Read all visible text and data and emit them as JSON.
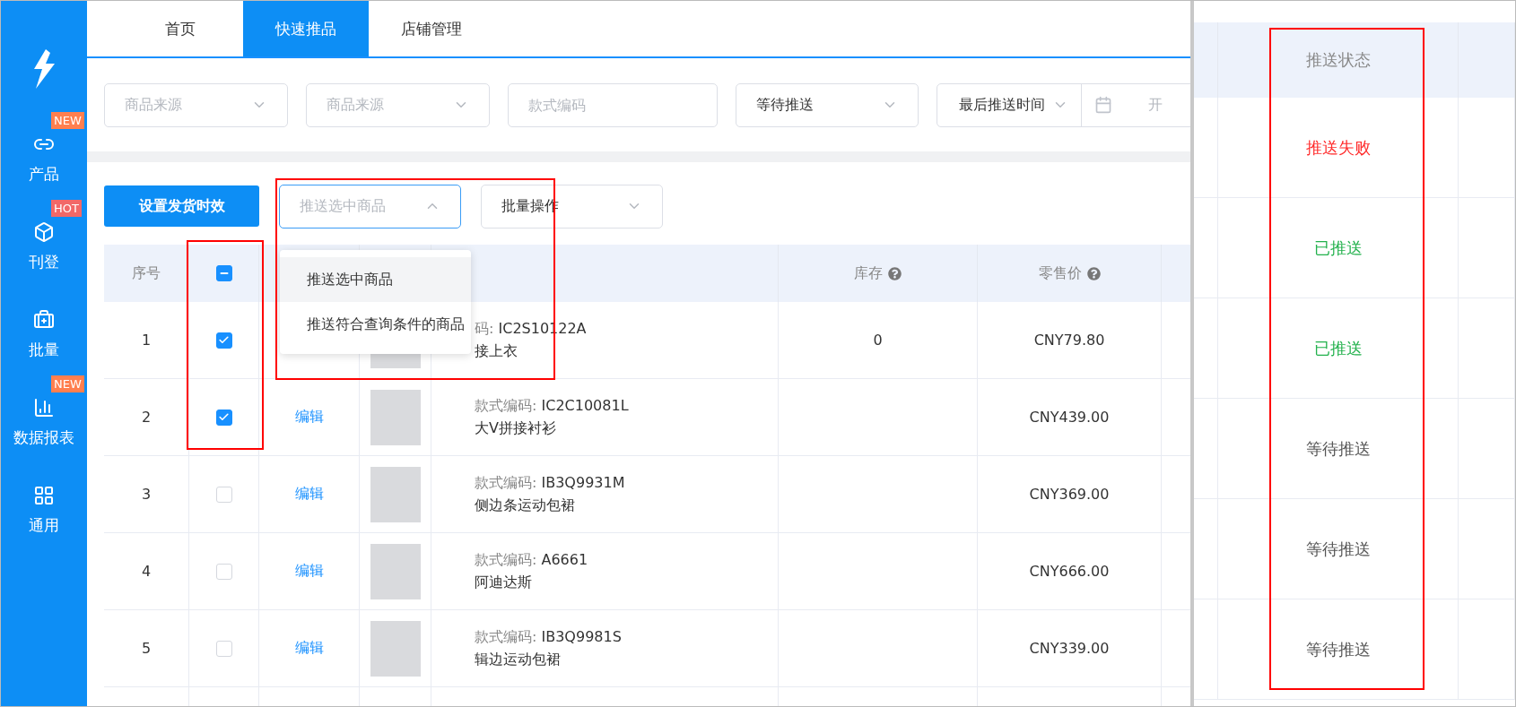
{
  "tabs": [
    {
      "label": "首页",
      "selected": false
    },
    {
      "label": "快速推品",
      "selected": true
    },
    {
      "label": "店铺管理",
      "selected": false
    }
  ],
  "sidebar": {
    "items": [
      {
        "label": "产品",
        "badge": {
          "text": "NEW",
          "color": "#ff7f4f"
        }
      },
      {
        "label": "刊登",
        "badge": {
          "text": "HOT",
          "color": "#f26868"
        }
      },
      {
        "label": "批量"
      },
      {
        "label": "数据报表",
        "badge": {
          "text": "NEW",
          "color": "#ff7f4f"
        }
      },
      {
        "label": "通用"
      }
    ]
  },
  "filters": [
    {
      "kind": "select",
      "placeholder": "商品来源"
    },
    {
      "kind": "select",
      "placeholder": "商品来源"
    },
    {
      "kind": "input",
      "placeholder": "款式编码"
    },
    {
      "kind": "select",
      "value": "等待推送"
    },
    {
      "kind": "daterange",
      "value": "最后推送时间",
      "placeholder": "开"
    }
  ],
  "actions": {
    "button": "设置发货时效",
    "push_select": {
      "placeholder": "推送选中商品",
      "open": true,
      "options": [
        {
          "label": "推送选中商品",
          "highlighted": true
        },
        {
          "label": "推送符合查询条件的商品",
          "highlighted": false
        }
      ]
    },
    "batch_select": {
      "value": "批量操作"
    }
  },
  "table": {
    "header": {
      "index": "序号",
      "indeterminate": true,
      "stock": "库存",
      "price": "零售价"
    },
    "rows": [
      {
        "index": "1",
        "checked": true,
        "code_label": "码:",
        "code": "IC2S10122A",
        "name": "接上衣",
        "stock": "0",
        "price": "CNY79.80"
      },
      {
        "index": "2",
        "checked": true,
        "edit": "编辑",
        "code_label": "款式编码:",
        "code": "IC2C10081L",
        "name": "大V拼接衬衫",
        "price": "CNY439.00"
      },
      {
        "index": "3",
        "checked": false,
        "edit": "编辑",
        "code_label": "款式编码:",
        "code": "IB3Q9931M",
        "name": "侧边条运动包裙",
        "price": "CNY369.00"
      },
      {
        "index": "4",
        "checked": false,
        "edit": "编辑",
        "code_label": "款式编码:",
        "code": "A6661",
        "name": "阿迪达斯",
        "price": "CNY666.00"
      },
      {
        "index": "5",
        "checked": false,
        "edit": "编辑",
        "code_label": "款式编码:",
        "code": "IB3Q9981S",
        "name": "辑边运动包裙",
        "price": "CNY339.00"
      }
    ]
  },
  "status_panel": {
    "header": "推送状态",
    "rows": [
      {
        "label": "推送失败",
        "color": "#ff2a2a"
      },
      {
        "label": "已推送",
        "color": "#22b14c"
      },
      {
        "label": "已推送",
        "color": "#22b14c"
      },
      {
        "label": "等待推送",
        "color": "#555555"
      },
      {
        "label": "等待推送",
        "color": "#555555"
      },
      {
        "label": "等待推送",
        "color": "#555555"
      }
    ]
  }
}
